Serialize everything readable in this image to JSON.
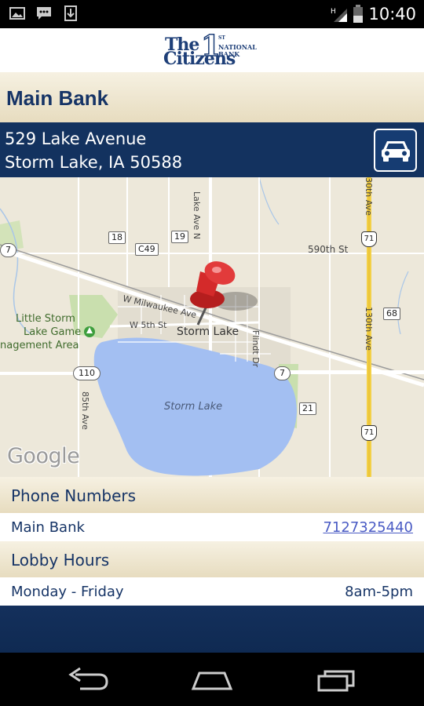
{
  "status_bar": {
    "time": "10:40",
    "icons": [
      "image-icon",
      "chat-icon",
      "download-icon",
      "signal-icon",
      "battery-icon"
    ]
  },
  "header": {
    "logo_the": "The",
    "logo_one": "1",
    "logo_national_line1": "ST",
    "logo_national_line2": "NATIONAL",
    "logo_national_line3": "BANK",
    "logo_citizens": "Citizens"
  },
  "branch": {
    "title": "Main Bank",
    "address_line1": "529 Lake Avenue",
    "address_line2": "Storm Lake, IA 50588",
    "directions_icon": "car-icon"
  },
  "map": {
    "labels": {
      "lake_ave": "Lake Ave N",
      "ave_30th": "30th Ave",
      "ave_130th": "130th Ave",
      "st_590th": "590th St",
      "milwaukee": "W Milwaukee Ave",
      "w5th": "W 5th St",
      "storm_lake_city": "Storm Lake",
      "storm_lake_water": "Storm Lake",
      "flindt": "Flindt Dr",
      "ave_85th": "85th Ave",
      "little_storm1": "Little Storm",
      "little_storm2": "Lake Game",
      "little_storm3": "nagement Area",
      "google": "Google"
    },
    "shields": {
      "r18": "18",
      "r19": "19",
      "c49": "C49",
      "r7_left": "7",
      "r7_right": "7",
      "r110": "110",
      "r68": "68",
      "r21": "21",
      "us71_top": "71",
      "us71_bottom": "71"
    }
  },
  "phone_section": {
    "header": "Phone Numbers",
    "rows": [
      {
        "label": "Main Bank",
        "value": "7127325440"
      }
    ]
  },
  "hours_section": {
    "header": "Lobby Hours",
    "rows": [
      {
        "label": "Monday - Friday",
        "value": "8am-5pm"
      }
    ]
  },
  "nav_bar": {
    "icons": [
      "back-icon",
      "home-icon",
      "recent-apps-icon"
    ]
  },
  "colors": {
    "navy": "#13325f",
    "beige": "#e7dcbf",
    "link": "#4a5bc4",
    "lake": "#a3bff2",
    "pin": "#d42a2a"
  }
}
